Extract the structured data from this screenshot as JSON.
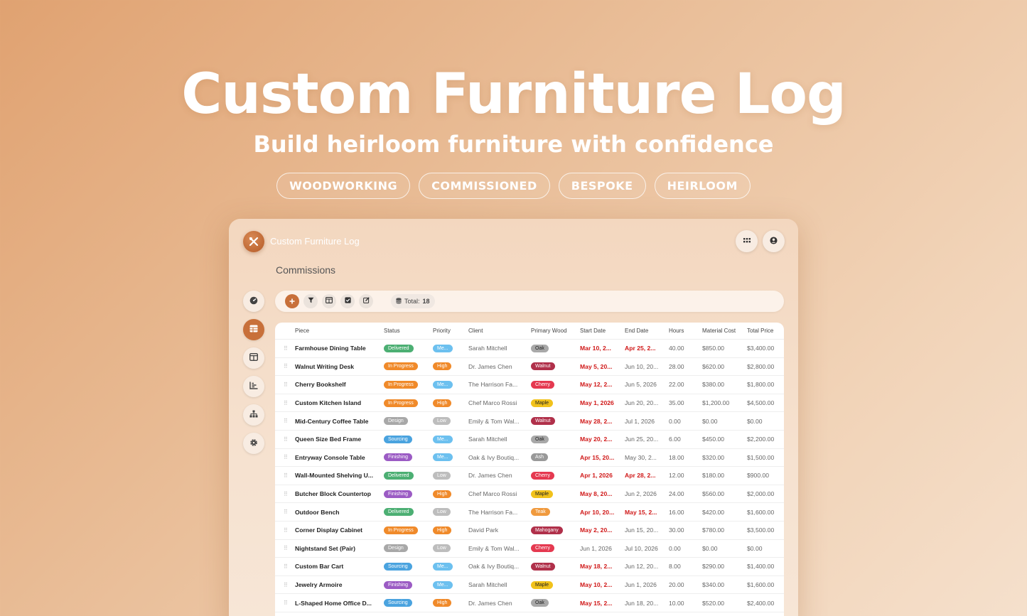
{
  "hero": {
    "title": "Custom Furniture Log",
    "subtitle": "Build heirloom furniture with confidence",
    "tags": [
      "WOODWORKING",
      "COMMISSIONED",
      "BESPOKE",
      "HEIRLOOM"
    ]
  },
  "app": {
    "title": "Custom Furniture Log",
    "section_title": "Commissions",
    "toolbar": {
      "total_label": "Total:",
      "total_value": "18"
    },
    "columns": [
      "Piece",
      "Status",
      "Priority",
      "Client",
      "Primary Wood",
      "Start Date",
      "End Date",
      "Hours",
      "Material Cost",
      "Total Price"
    ],
    "colors": {
      "accent": "#c8703a",
      "status": {
        "Delivered": "#4caf73",
        "In Progress": "#f08a2a",
        "Design": "#a8a8a8",
        "Sourcing": "#4aa3df",
        "Finishing": "#9b5bc4"
      },
      "priority": {
        "Me...": "#6cc0ef",
        "High": "#f08a2a",
        "Low": "#bdbdbd"
      },
      "wood": {
        "Oak": "#a8a8a8",
        "Walnut": "#b0304a",
        "Cherry": "#e53950",
        "Maple": "#f1c21b",
        "Ash": "#999999",
        "Teak": "#f09a3e",
        "Mahogany": "#b0304a"
      }
    },
    "rows": [
      {
        "piece": "Farmhouse Dining Table",
        "status": "Delivered",
        "priority": "Me...",
        "client": "Sarah Mitchell",
        "wood": "Oak",
        "start": "Mar 10, 2...",
        "start_red": true,
        "end": "Apr 25, 2...",
        "end_red": true,
        "hours": "40.00",
        "material": "$850.00",
        "price": "$3,400.00"
      },
      {
        "piece": "Walnut Writing Desk",
        "status": "In Progress",
        "priority": "High",
        "client": "Dr. James Chen",
        "wood": "Walnut",
        "start": "May 5, 20...",
        "start_red": true,
        "end": "Jun 10, 20...",
        "end_red": false,
        "hours": "28.00",
        "material": "$620.00",
        "price": "$2,800.00"
      },
      {
        "piece": "Cherry Bookshelf",
        "status": "In Progress",
        "priority": "Me...",
        "client": "The Harrison Fa...",
        "wood": "Cherry",
        "start": "May 12, 2...",
        "start_red": true,
        "end": "Jun 5, 2026",
        "end_red": false,
        "hours": "22.00",
        "material": "$380.00",
        "price": "$1,800.00"
      },
      {
        "piece": "Custom Kitchen Island",
        "status": "In Progress",
        "priority": "High",
        "client": "Chef Marco Rossi",
        "wood": "Maple",
        "start": "May 1, 2026",
        "start_red": true,
        "end": "Jun 20, 20...",
        "end_red": false,
        "hours": "35.00",
        "material": "$1,200.00",
        "price": "$4,500.00"
      },
      {
        "piece": "Mid-Century Coffee Table",
        "status": "Design",
        "priority": "Low",
        "client": "Emily & Tom Wal...",
        "wood": "Walnut",
        "start": "May 28, 2...",
        "start_red": true,
        "end": "Jul 1, 2026",
        "end_red": false,
        "hours": "0.00",
        "material": "$0.00",
        "price": "$0.00"
      },
      {
        "piece": "Queen Size Bed Frame",
        "status": "Sourcing",
        "priority": "Me...",
        "client": "Sarah Mitchell",
        "wood": "Oak",
        "start": "May 20, 2...",
        "start_red": true,
        "end": "Jun 25, 20...",
        "end_red": false,
        "hours": "6.00",
        "material": "$450.00",
        "price": "$2,200.00"
      },
      {
        "piece": "Entryway Console Table",
        "status": "Finishing",
        "priority": "Me...",
        "client": "Oak & Ivy Boutiq...",
        "wood": "Ash",
        "start": "Apr 15, 20...",
        "start_red": true,
        "end": "May 30, 2...",
        "end_red": false,
        "hours": "18.00",
        "material": "$320.00",
        "price": "$1,500.00"
      },
      {
        "piece": "Wall-Mounted Shelving U...",
        "status": "Delivered",
        "priority": "Low",
        "client": "Dr. James Chen",
        "wood": "Cherry",
        "start": "Apr 1, 2026",
        "start_red": true,
        "end": "Apr 28, 2...",
        "end_red": true,
        "hours": "12.00",
        "material": "$180.00",
        "price": "$900.00"
      },
      {
        "piece": "Butcher Block Countertop",
        "status": "Finishing",
        "priority": "High",
        "client": "Chef Marco Rossi",
        "wood": "Maple",
        "start": "May 8, 20...",
        "start_red": true,
        "end": "Jun 2, 2026",
        "end_red": false,
        "hours": "24.00",
        "material": "$560.00",
        "price": "$2,000.00"
      },
      {
        "piece": "Outdoor Bench",
        "status": "Delivered",
        "priority": "Low",
        "client": "The Harrison Fa...",
        "wood": "Teak",
        "start": "Apr 10, 20...",
        "start_red": true,
        "end": "May 15, 2...",
        "end_red": true,
        "hours": "16.00",
        "material": "$420.00",
        "price": "$1,600.00"
      },
      {
        "piece": "Corner Display Cabinet",
        "status": "In Progress",
        "priority": "High",
        "client": "David Park",
        "wood": "Mahogany",
        "start": "May 2, 20...",
        "start_red": true,
        "end": "Jun 15, 20...",
        "end_red": false,
        "hours": "30.00",
        "material": "$780.00",
        "price": "$3,500.00"
      },
      {
        "piece": "Nightstand Set (Pair)",
        "status": "Design",
        "priority": "Low",
        "client": "Emily & Tom Wal...",
        "wood": "Cherry",
        "start": "Jun 1, 2026",
        "start_red": false,
        "end": "Jul 10, 2026",
        "end_red": false,
        "hours": "0.00",
        "material": "$0.00",
        "price": "$0.00"
      },
      {
        "piece": "Custom Bar Cart",
        "status": "Sourcing",
        "priority": "Me...",
        "client": "Oak & Ivy Boutiq...",
        "wood": "Walnut",
        "start": "May 18, 2...",
        "start_red": true,
        "end": "Jun 12, 20...",
        "end_red": false,
        "hours": "8.00",
        "material": "$290.00",
        "price": "$1,400.00"
      },
      {
        "piece": "Jewelry Armoire",
        "status": "Finishing",
        "priority": "Me...",
        "client": "Sarah Mitchell",
        "wood": "Maple",
        "start": "May 10, 2...",
        "start_red": true,
        "end": "Jun 1, 2026",
        "end_red": false,
        "hours": "20.00",
        "material": "$340.00",
        "price": "$1,600.00"
      },
      {
        "piece": "L-Shaped Home Office D...",
        "status": "Sourcing",
        "priority": "High",
        "client": "Dr. James Chen",
        "wood": "Oak",
        "start": "May 15, 2...",
        "start_red": true,
        "end": "Jun 18, 20...",
        "end_red": false,
        "hours": "10.00",
        "material": "$520.00",
        "price": "$2,400.00"
      },
      {
        "piece": "",
        "status": "",
        "priority": "",
        "client": "",
        "wood": "",
        "start": "",
        "start_red": false,
        "end": "",
        "end_red": false,
        "hours": "",
        "material": "",
        "price": ""
      }
    ]
  },
  "icons": {
    "logo": "tools-icon",
    "apps": "grid-icon",
    "account": "user-circle-icon",
    "sidebar": [
      "dashboard-icon",
      "table-icon",
      "board-icon",
      "chart-icon",
      "hierarchy-icon",
      "gear-icon"
    ],
    "toolbar": [
      "plus-icon",
      "filter-icon",
      "columns-icon",
      "checkbox-icon",
      "edit-icon",
      "database-icon"
    ]
  }
}
